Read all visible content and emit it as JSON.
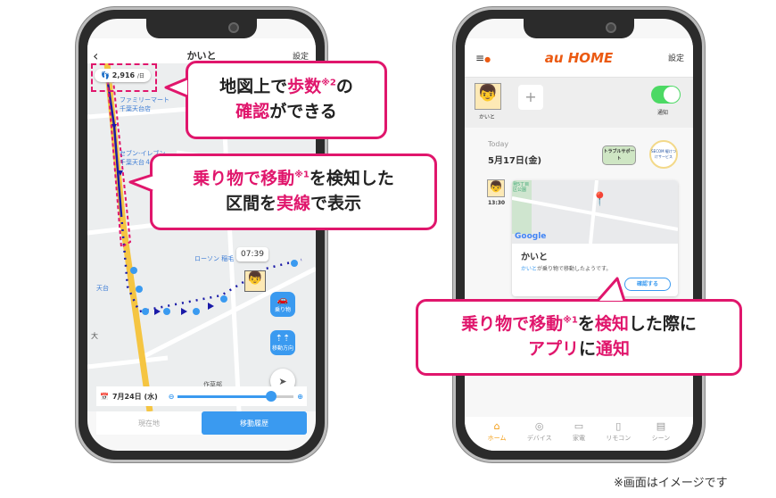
{
  "left_phone": {
    "header": {
      "back_icon": "chevron-left-icon",
      "title": "かいと",
      "settings": "設定"
    },
    "steps": {
      "value": "2,916",
      "unit": "/日",
      "icon": "footprints-icon"
    },
    "map_labels": [
      "ファミリーマート",
      "千葉天台店",
      "セブン-イレブン",
      "千葉天台４丁目店",
      "ローソン 稲毛",
      "天台",
      "大",
      "作草部"
    ],
    "time_label": "07:39",
    "buttons": {
      "vehicle": "乗り物",
      "direction": "移動方向"
    },
    "date_bar": {
      "date": "7月24日 (水)",
      "slider_value": 0.78
    },
    "tabs": {
      "current": "現在地",
      "history": "移動履歴",
      "active": "history"
    }
  },
  "right_phone": {
    "header": {
      "logo": "au HOME",
      "settings": "設定"
    },
    "profile": {
      "name": "かいと",
      "add": "+",
      "notify_label": "通知",
      "notify_on": true
    },
    "today": {
      "label": "Today",
      "date": "5月17日(金)",
      "trouble_badge": "トラブルサポート",
      "secom_badge": "SECOM 駆けつけサービス"
    },
    "event": {
      "time": "13:30",
      "map_label": "発5丁目区公園",
      "google": "Google",
      "title": "かいと",
      "message_name": "かいと",
      "message_rest": "が乗り物で移動したようです。",
      "confirm": "確認する"
    },
    "nav": [
      {
        "label": "ホーム",
        "icon": "home-icon",
        "active": true
      },
      {
        "label": "デバイス",
        "icon": "device-icon"
      },
      {
        "label": "家電",
        "icon": "tv-icon"
      },
      {
        "label": "リモコン",
        "icon": "remote-icon"
      },
      {
        "label": "シーン",
        "icon": "clapper-icon"
      }
    ]
  },
  "callouts": {
    "steps": {
      "l1a": "地図上で",
      "l1b": "歩数",
      "l1sup": "※2",
      "l1c": "の",
      "l2a": "確認",
      "l2b": "ができる"
    },
    "route": {
      "l1a": "乗り物で移動",
      "l1sup": "※1",
      "l1b": "を検知した",
      "l2a": "区間を",
      "l2b": "実線",
      "l2c": "で表示"
    },
    "notify": {
      "l1a": "乗り物で移動",
      "l1sup": "※1",
      "l1b": "を",
      "l1c": "検知",
      "l1d": "した際に",
      "l2a": "アプリ",
      "l2b": "に",
      "l2c": "通知"
    }
  },
  "footnote": "※画面はイメージです",
  "colors": {
    "accent": "#e0166c",
    "route": "#1a1aa8",
    "blue": "#3a9af0",
    "au_orange": "#eb5a12",
    "toggle": "#4cd964"
  }
}
